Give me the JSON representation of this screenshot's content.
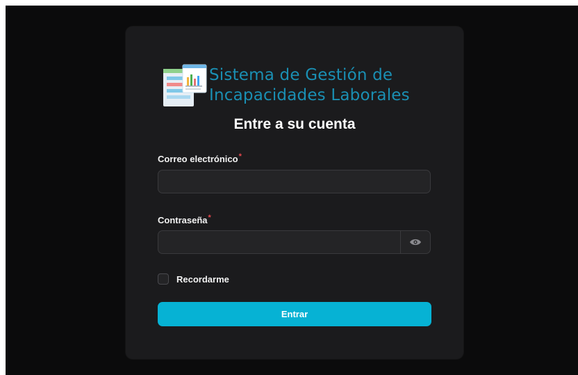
{
  "app": {
    "title_line1": "Sistema de Gestión de",
    "title_line2": "Incapacidades Laborales"
  },
  "login": {
    "heading": "Entre a su cuenta",
    "email_label": "Correo electrónico",
    "email_value": "",
    "password_label": "Contraseña",
    "password_value": "",
    "required_mark": "*",
    "remember_label": "Recordarme",
    "submit_label": "Entrar"
  },
  "colors": {
    "accent": "#06b2d4",
    "brand_text": "#1a8fb3",
    "required": "#e5484d",
    "card": "#1b1b1d",
    "background": "#0b0b0c"
  },
  "icons": {
    "logo": "spreadsheet-chart-icon",
    "password_toggle": "eye-icon",
    "remember": "checkbox-unchecked"
  }
}
